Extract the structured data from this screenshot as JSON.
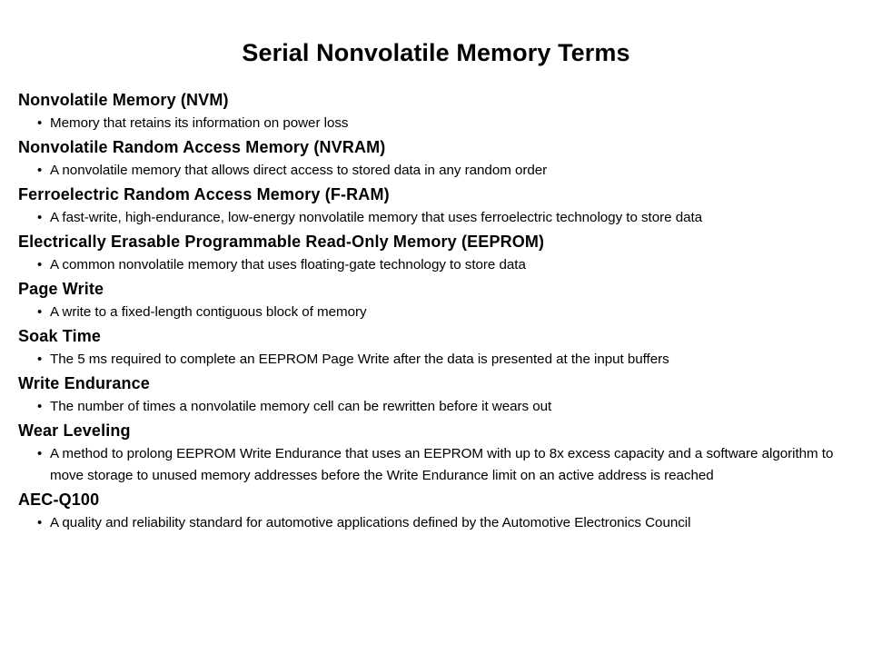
{
  "slide": {
    "title": "Serial Nonvolatile Memory Terms",
    "bullet_glyph": "•",
    "text_color": "#000000",
    "background_color": "#FFFFFF",
    "terms": [
      {
        "name": "Nonvolatile Memory (NVM)",
        "definition": "Memory that retains its information on power loss"
      },
      {
        "name": "Nonvolatile Random Access Memory (NVRAM)",
        "definition": "A nonvolatile memory that allows direct access to stored data in any random order"
      },
      {
        "name": "Ferroelectric Random Access Memory (F-RAM)",
        "definition": "A fast-write, high-endurance, low-energy nonvolatile memory that uses ferroelectric technology to store data"
      },
      {
        "name": "Electrically Erasable Programmable Read-Only Memory (EEPROM)",
        "definition": "A common nonvolatile memory that uses floating-gate technology to store data"
      },
      {
        "name": "Page Write",
        "definition": "A write to a fixed-length contiguous block of memory"
      },
      {
        "name": "Soak Time",
        "definition": "The 5 ms required to complete an EEPROM Page Write after the data is presented at the input buffers"
      },
      {
        "name": "Write Endurance",
        "definition": "The number of times a nonvolatile memory cell can be rewritten before it wears out"
      },
      {
        "name": "Wear Leveling",
        "definition": "A method to prolong EEPROM Write Endurance that uses an EEPROM with up to 8x excess capacity and a software algorithm to move storage to unused memory addresses before the Write Endurance limit on an active address is reached"
      },
      {
        "name": "AEC-Q100",
        "definition": "A quality and reliability standard for automotive applications defined by the Automotive Electronics Council"
      }
    ]
  }
}
